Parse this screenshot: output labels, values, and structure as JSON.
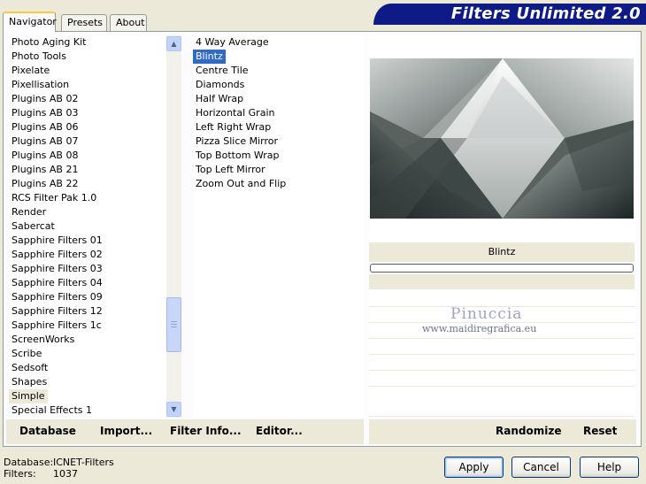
{
  "tabs": [
    {
      "label": "Navigator",
      "active": true
    },
    {
      "label": "Presets",
      "active": false
    },
    {
      "label": "About",
      "active": false
    }
  ],
  "brand": {
    "title": "Filters Unlimited 2.0",
    "color": "#0E1B86"
  },
  "categories": {
    "items": [
      "Photo Aging Kit",
      "Photo Tools",
      "Pixelate",
      "Pixellisation",
      "Plugins AB 02",
      "Plugins AB 03",
      "Plugins AB 06",
      "Plugins AB 07",
      "Plugins AB 08",
      "Plugins AB 21",
      "Plugins AB 22",
      "RCS Filter Pak 1.0",
      "Render",
      "Sabercat",
      "Sapphire Filters 01",
      "Sapphire Filters 02",
      "Sapphire Filters 03",
      "Sapphire Filters 04",
      "Sapphire Filters 09",
      "Sapphire Filters 12",
      "Sapphire Filters 1c",
      "ScreenWorks",
      "Scribe",
      "Sedsoft",
      "Shapes",
      "Simple",
      "Special Effects 1"
    ],
    "selected": "Simple"
  },
  "filters": {
    "items": [
      "4 Way Average",
      "Blintz",
      "Centre Tile",
      "Diamonds",
      "Half Wrap",
      "Horizontal Grain",
      "Left Right Wrap",
      "Pizza Slice Mirror",
      "Top Bottom Wrap",
      "Top Left Mirror",
      "Zoom Out and Flip"
    ],
    "selected": "Blintz",
    "selection_color": "#316AC5"
  },
  "preview": {
    "filter_name": "Blintz",
    "watermark_name": "Pinuccia",
    "watermark_url": "www.maidiregrafica.eu"
  },
  "left_buttons": {
    "database": "Database",
    "import": "Import...",
    "filter_info": "Filter Info...",
    "editor": "Editor..."
  },
  "right_buttons": {
    "randomize": "Randomize",
    "reset": "Reset"
  },
  "status": {
    "database_label": "Database:",
    "database_value": "ICNET-Filters",
    "filters_label": "Filters:",
    "filters_value": "1037"
  },
  "dialog_buttons": {
    "apply": "Apply",
    "cancel": "Cancel",
    "help": "Help"
  }
}
